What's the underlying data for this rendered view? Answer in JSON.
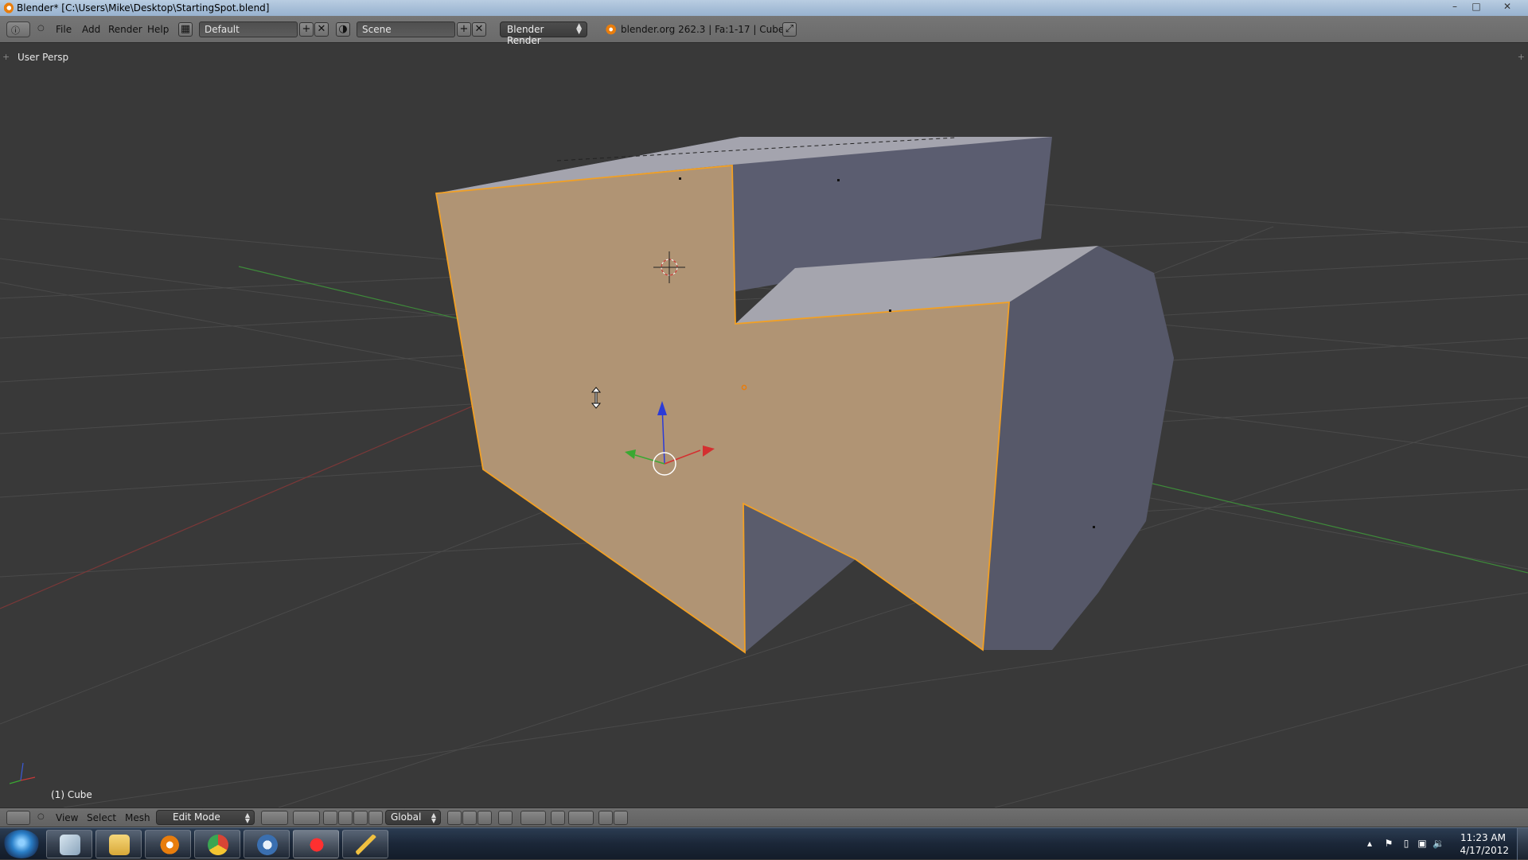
{
  "window": {
    "title": "Blender* [C:\\Users\\Mike\\Desktop\\StartingSpot.blend]",
    "minimize_icon": "minimize-icon",
    "maximize_icon": "maximize-icon",
    "close_icon": "close-icon"
  },
  "info_header": {
    "menus": [
      "File",
      "Add",
      "Render",
      "Help"
    ],
    "screen_layout": "Default",
    "scene": "Scene",
    "render_engine": "Blender Render",
    "stats": "blender.org 262.3 | Fa:1-17 | Cube"
  },
  "viewport": {
    "view_name": "User Persp",
    "object_name": "(1) Cube",
    "colors": {
      "background": "#393939",
      "grid": "#4a4a4a",
      "x_axis": "#8a3b3b",
      "y_axis": "#4f8a3b",
      "selected_face": "#b09474",
      "selected_edge": "#f2a024",
      "unselected_face": "#585a6c",
      "top_face": "#9c9ca6"
    }
  },
  "view_header": {
    "menus": [
      "View",
      "Select",
      "Mesh"
    ],
    "mode": "Edit Mode",
    "orientation": "Global"
  },
  "taskbar": {
    "apps": [
      "explorer-icon",
      "file-manager-icon",
      "blender-icon",
      "chrome-icon",
      "browser-icon",
      "paint-icon",
      "writer-icon"
    ],
    "clock_time": "11:23 AM",
    "clock_date": "4/17/2012"
  }
}
